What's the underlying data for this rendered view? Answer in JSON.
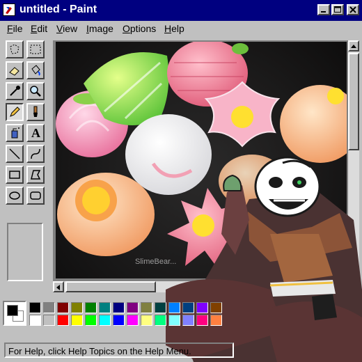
{
  "window": {
    "title": "untitled - Paint"
  },
  "menu": [
    {
      "label": "File"
    },
    {
      "label": "Edit"
    },
    {
      "label": "View"
    },
    {
      "label": "Image"
    },
    {
      "label": "Options"
    },
    {
      "label": "Help"
    }
  ],
  "tools": [
    "free-select-icon",
    "rect-select-icon",
    "eraser-icon",
    "fill-icon",
    "eyedropper-icon",
    "magnifier-icon",
    "pencil-icon",
    "brush-icon",
    "airbrush-icon",
    "text-icon",
    "line-icon",
    "curve-icon",
    "rectangle-icon",
    "polygon-icon",
    "ellipse-icon",
    "rounded-rect-icon"
  ],
  "active_tool": "pencil-icon",
  "text_tool_glyph": "A",
  "canvas": {
    "watermark": "SlimeBear..."
  },
  "palette": {
    "foreground": "#000000",
    "background": "#ffffff",
    "row1": [
      "#000000",
      "#808080",
      "#800000",
      "#808000",
      "#008000",
      "#008080",
      "#000080",
      "#800080",
      "#808040",
      "#004040",
      "#0080ff",
      "#004080",
      "#8000ff",
      "#804000"
    ],
    "row2": [
      "#ffffff",
      "#c0c0c0",
      "#ff0000",
      "#ffff00",
      "#00ff00",
      "#00ffff",
      "#0000ff",
      "#ff00ff",
      "#ffff80",
      "#00ff80",
      "#80ffff",
      "#8080ff",
      "#ff0080",
      "#ff8040"
    ]
  },
  "status": {
    "text": "For Help, click Help Topics on the Help Menu."
  }
}
